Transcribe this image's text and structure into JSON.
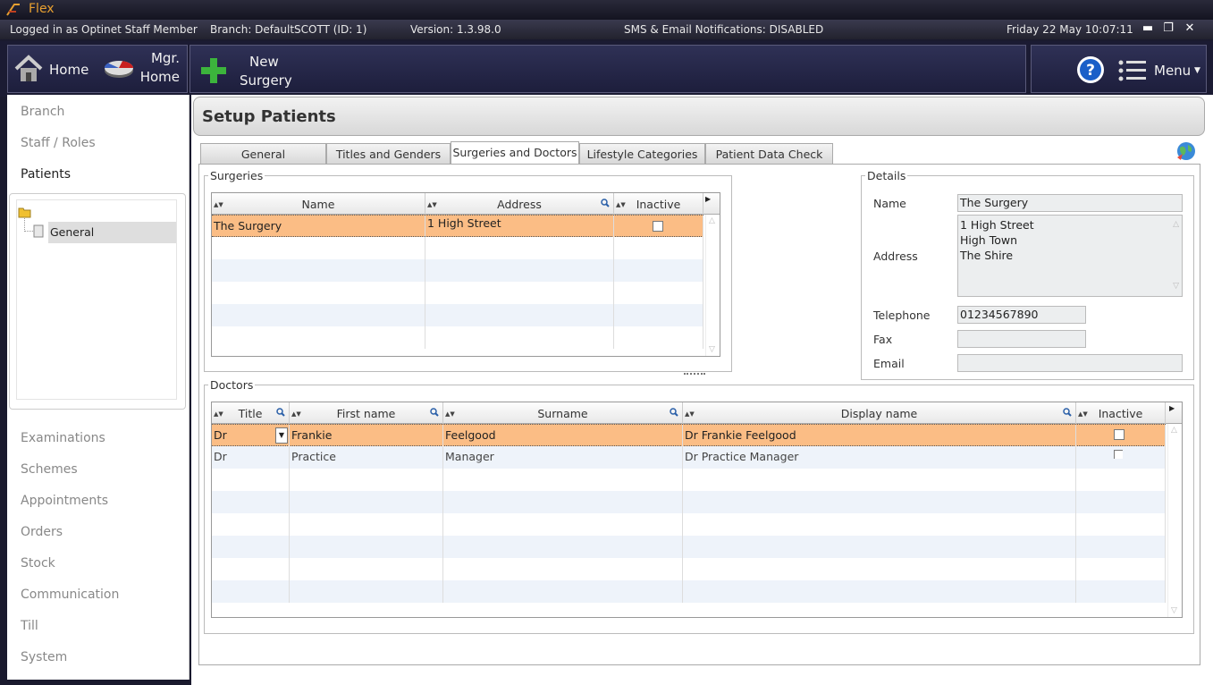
{
  "app": {
    "title": "Flex"
  },
  "info": {
    "logged_in": "Logged in as Optinet Staff Member",
    "branch": "Branch: DefaultSCOTT (ID:  1)",
    "version": "Version: 1.3.98.0",
    "notifications": "SMS & Email Notifications: DISABLED",
    "datetime": "Friday 22 May 10:07:11"
  },
  "window": {
    "minimize": "▬",
    "restore": "❐",
    "close": "✕"
  },
  "toolbar": {
    "home": "Home",
    "mgr_line1": "Mgr.",
    "mgr_line2": "Home",
    "new_line1": "New",
    "new_line2": "Surgery",
    "menu": "Menu"
  },
  "sidebar": {
    "top_items": [
      "Branch",
      "Staff / Roles",
      "Patients"
    ],
    "tree_item": "General",
    "bottom_items": [
      "Examinations",
      "Schemes",
      "Appointments",
      "Orders",
      "Stock",
      "Communication",
      "Till",
      "System"
    ]
  },
  "page": {
    "title": "Setup Patients"
  },
  "tabs": [
    "General",
    "Titles and Genders",
    "Surgeries and Doctors",
    "Lifestyle Categories",
    "Patient Data Check"
  ],
  "surgeries": {
    "legend": "Surgeries",
    "columns": [
      "Name",
      "Address",
      "Inactive"
    ],
    "rows": [
      {
        "name": "The Surgery",
        "address": "1 High Street",
        "inactive": false
      }
    ]
  },
  "details": {
    "legend": "Details",
    "name_label": "Name",
    "name_value": "The Surgery",
    "address_label": "Address",
    "address_line1": "1 High Street",
    "address_line2": "High Town",
    "address_line3": "The Shire",
    "telephone_label": "Telephone",
    "telephone_value": "01234567890",
    "fax_label": "Fax",
    "fax_value": "",
    "email_label": "Email",
    "email_value": ""
  },
  "doctors": {
    "legend": "Doctors",
    "columns": [
      "Title",
      "First name",
      "Surname",
      "Display name",
      "Inactive"
    ],
    "rows": [
      {
        "title": "Dr",
        "first": "Frankie",
        "surname": "Feelgood",
        "display": "Dr Frankie Feelgood",
        "inactive": false
      },
      {
        "title": "Dr",
        "first": "Practice",
        "surname": "Manager",
        "display": "Dr Practice Manager",
        "inactive": false
      }
    ]
  },
  "colors": {
    "selected_row": "#fbbd85",
    "alt_row": "#eef3fa",
    "title_accent": "#e8a030"
  }
}
